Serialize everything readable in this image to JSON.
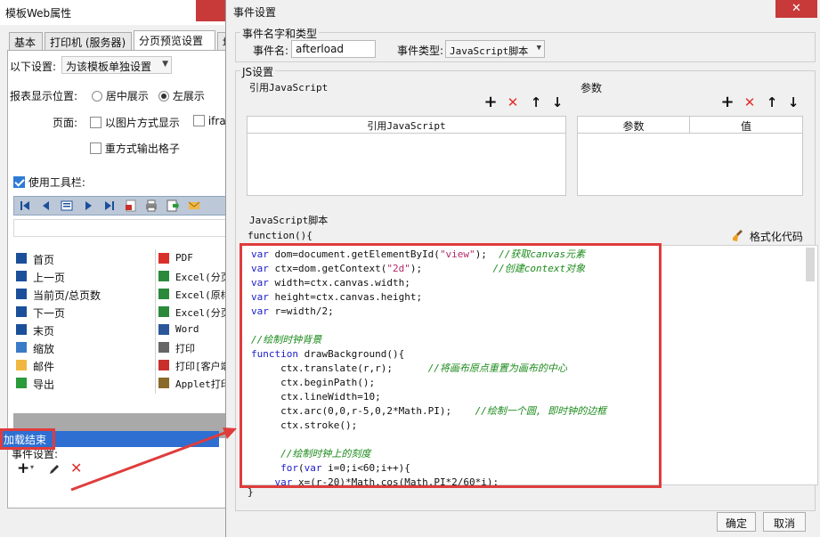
{
  "left_window": {
    "title": "模板Web属性",
    "tabs": [
      {
        "label": "基本"
      },
      {
        "label": "打印机 (服务器)"
      },
      {
        "label": "分页预览设置"
      },
      {
        "label": "填"
      }
    ],
    "settings": {
      "following_label": "以下设置:",
      "following_value": "为该模板单独设置",
      "report_position_label": "报表显示位置:",
      "report_position_options": [
        "居中展示",
        "左展示"
      ],
      "report_position_selected": "左展示",
      "page_label": "页面:",
      "page_options": [
        "以图片方式显示",
        "ifra",
        "重方式输出格子"
      ],
      "use_toolbar_label": "使用工具栏:",
      "use_toolbar_checked": true
    },
    "toolbar_buttons": [
      {
        "label": "首页",
        "icon": "first-page-icon"
      },
      {
        "label": "PDF",
        "icon": "pdf-icon"
      },
      {
        "label": "上一页",
        "icon": "prev-page-icon"
      },
      {
        "label": "Excel(分页",
        "icon": "excel-icon"
      },
      {
        "label": "当前页/总页数",
        "icon": "page-count-icon"
      },
      {
        "label": "Excel(原样",
        "icon": "excel-icon"
      },
      {
        "label": "下一页",
        "icon": "next-page-icon"
      },
      {
        "label": "Excel(分页",
        "icon": "excel-icon"
      },
      {
        "label": "末页",
        "icon": "last-page-icon"
      },
      {
        "label": "Word",
        "icon": "word-icon"
      },
      {
        "label": "缩放",
        "icon": "zoom-icon"
      },
      {
        "label": "打印",
        "icon": "print-icon"
      },
      {
        "label": "邮件",
        "icon": "mail-icon"
      },
      {
        "label": "打印[客户端",
        "icon": "client-print-icon"
      },
      {
        "label": "导出",
        "icon": "export-icon"
      },
      {
        "label": "Applet打印",
        "icon": "applet-print-icon"
      }
    ],
    "event_settings_label": "事件设置:",
    "events": [
      "加载结束"
    ]
  },
  "dialog": {
    "title": "事件设置",
    "close_glyph": "✕",
    "name_group_label": "事件名字和类型",
    "event_name_label": "事件名:",
    "event_name_value": "afterload",
    "event_type_label": "事件类型:",
    "event_type_value": "JavaScript脚本",
    "js_group_label": "JS设置",
    "ref_js_label": "引用JavaScript",
    "param_label": "参数",
    "ref_js_col": "引用JavaScript",
    "param_cols": [
      "参数",
      "值"
    ],
    "script_label": "JavaScript脚本",
    "function_header": "function(){",
    "format_code_label": "格式化代码",
    "function_footer": "}",
    "code_lines": [
      {
        "code": "var dom=document.getElementById(\"view\");",
        "comment": "  //获取canvas元素"
      },
      {
        "code": "var ctx=dom.getContext(\"2d\");",
        "comment": "            //创建context对象"
      },
      {
        "code": "var width=ctx.canvas.width;",
        "comment": ""
      },
      {
        "code": "var height=ctx.canvas.height;",
        "comment": ""
      },
      {
        "code": "var r=width/2;",
        "comment": ""
      },
      {
        "code": "",
        "comment": ""
      },
      {
        "code": "",
        "comment": "//绘制时钟背景"
      },
      {
        "code": "function drawBackground(){",
        "comment": ""
      },
      {
        "code": "     ctx.translate(r,r);",
        "comment": "      //将画布原点重置为画布的中心"
      },
      {
        "code": "     ctx.beginPath();",
        "comment": ""
      },
      {
        "code": "     ctx.lineWidth=10;",
        "comment": ""
      },
      {
        "code": "     ctx.arc(0,0,r-5,0,2*Math.PI);",
        "comment": "    //绘制一个圆, 即时钟的边框"
      },
      {
        "code": "     ctx.stroke();",
        "comment": ""
      },
      {
        "code": "",
        "comment": ""
      },
      {
        "code": "     ",
        "comment": "//绘制时钟上的刻度"
      },
      {
        "code": "     for(var i=0;i<60;i++){",
        "comment": ""
      },
      {
        "code": "    var x=(r-20)*Math.cos(Math.PI*2/60*i);",
        "comment": ""
      }
    ],
    "ok_label": "确定",
    "cancel_label": "取消"
  }
}
